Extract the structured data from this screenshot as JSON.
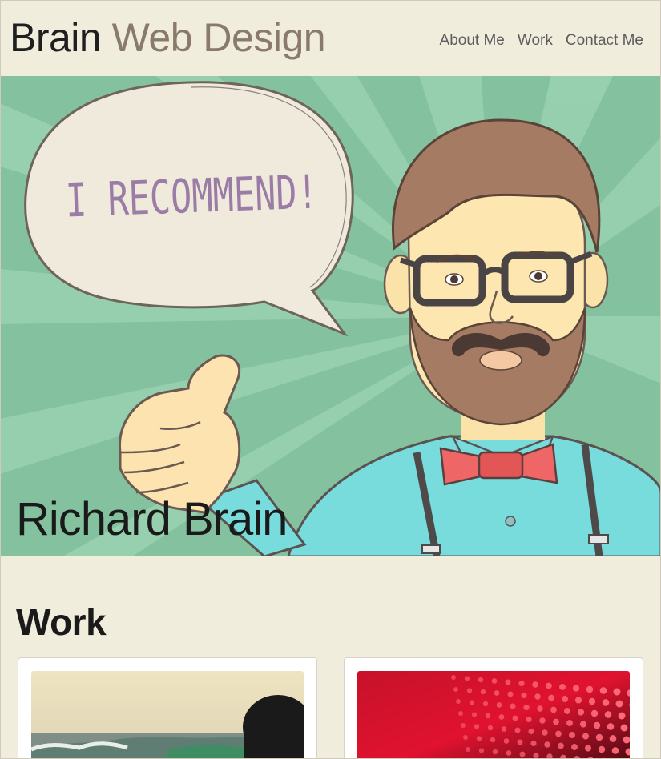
{
  "header": {
    "brand_primary": "Brain",
    "brand_secondary": "Web Design",
    "nav": [
      {
        "label": "About Me"
      },
      {
        "label": "Work"
      },
      {
        "label": "Contact Me"
      }
    ]
  },
  "hero": {
    "speech_text": "I RECOMMEND!",
    "name": "Richard Brain"
  },
  "work": {
    "title": "Work",
    "cards": [
      {
        "image": "beach-surf-photo"
      },
      {
        "image": "red-led-lights-photo"
      }
    ]
  },
  "colors": {
    "background": "#f1eddd",
    "brand_secondary": "#8a7a6c",
    "hero_green": "#85c3a0",
    "nav_text": "#5d5d5d"
  }
}
